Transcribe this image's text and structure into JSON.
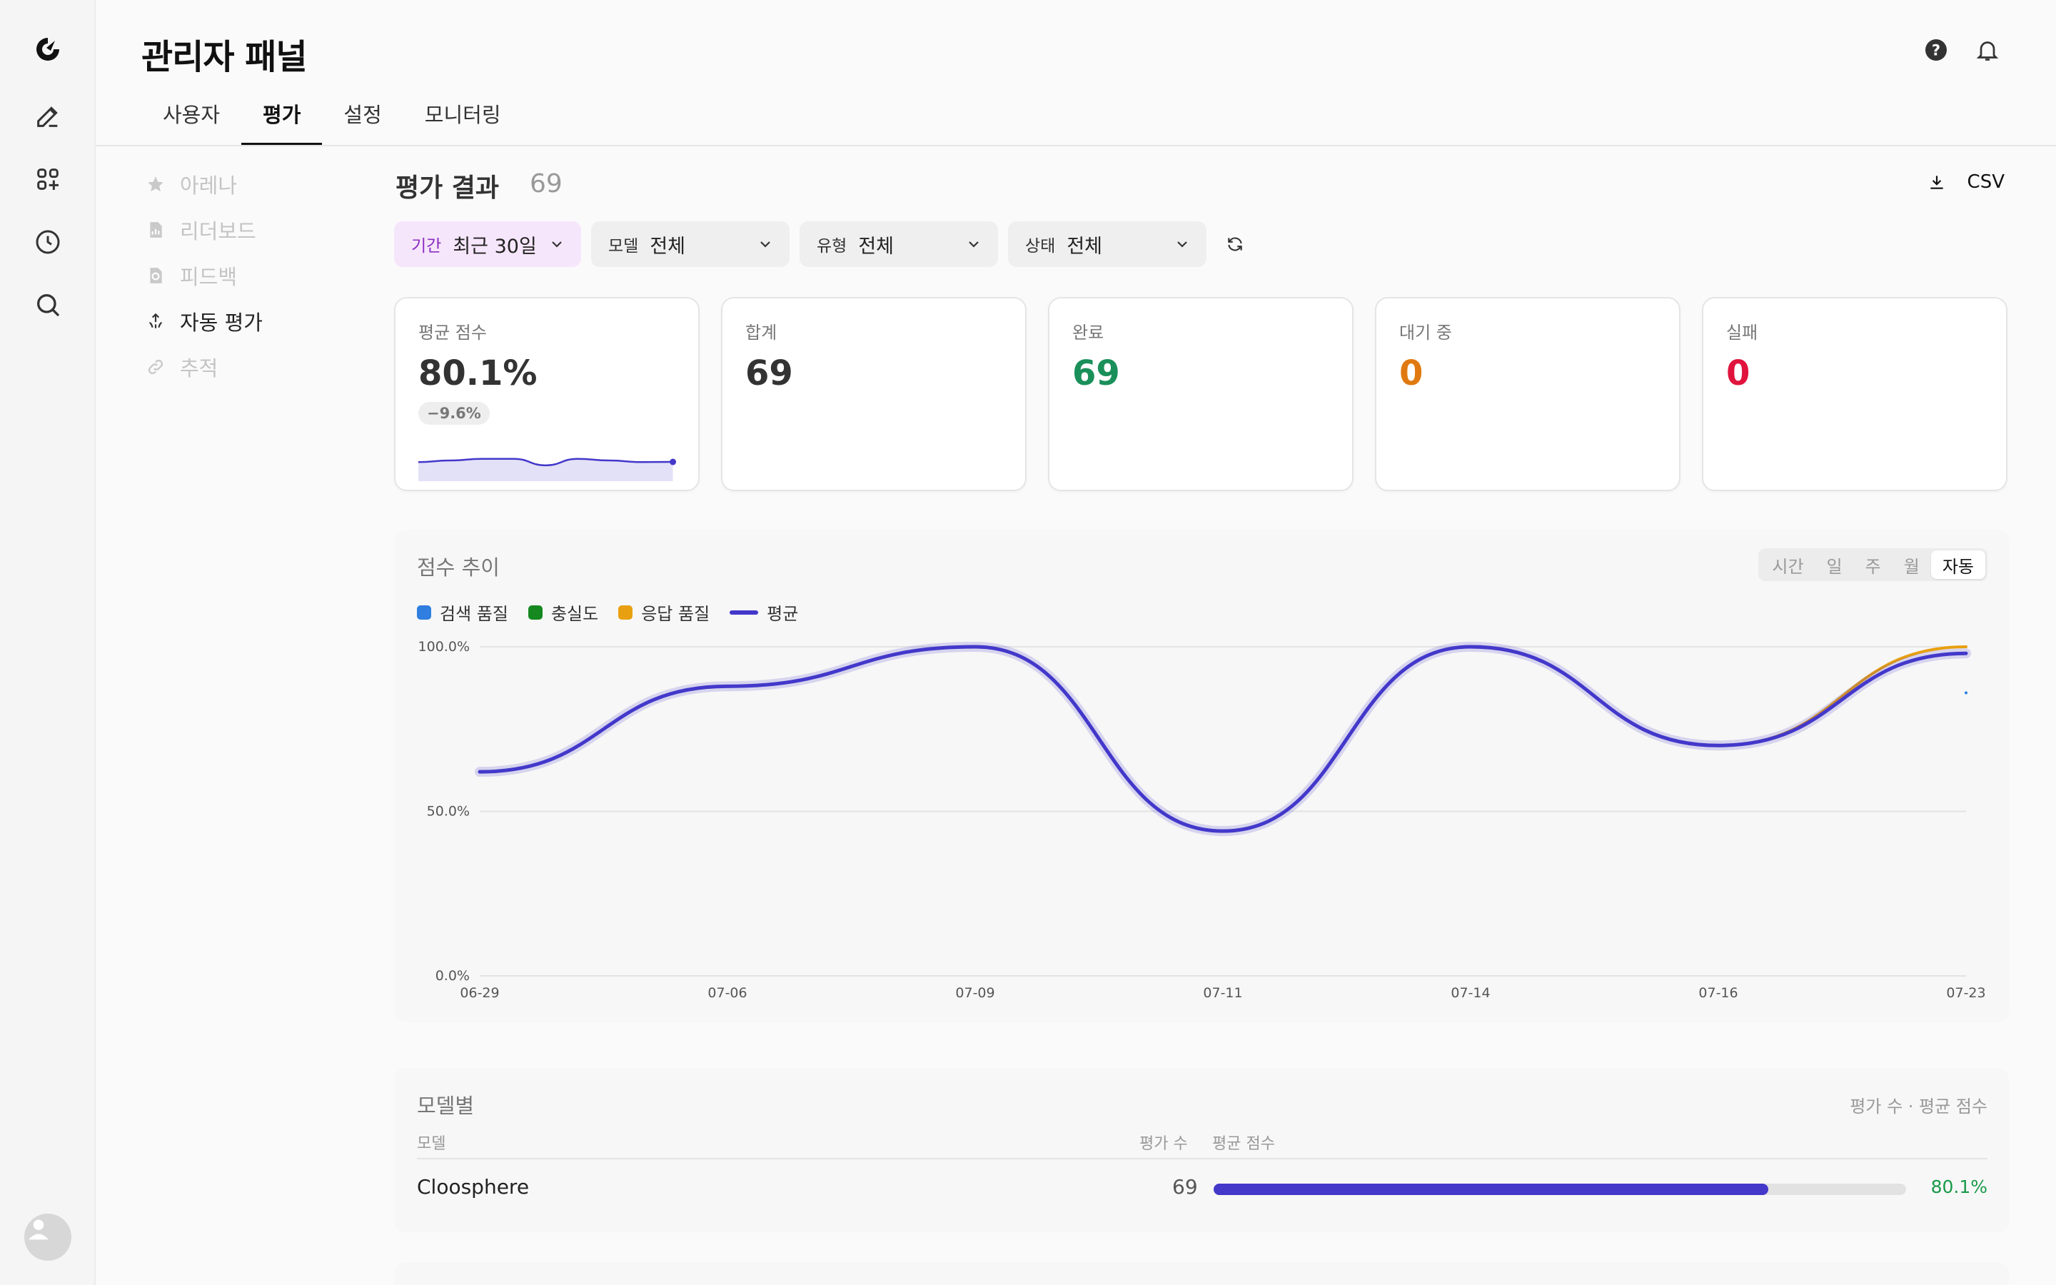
{
  "app": {
    "title": "관리자 패널"
  },
  "tabs": [
    {
      "label": "사용자",
      "active": false
    },
    {
      "label": "평가",
      "active": true
    },
    {
      "label": "설정",
      "active": false
    },
    {
      "label": "모니터링",
      "active": false
    }
  ],
  "subnav": [
    {
      "label": "아레나",
      "icon": "star-icon",
      "active": false
    },
    {
      "label": "리더보드",
      "icon": "chart-doc-icon",
      "active": false
    },
    {
      "label": "피드백",
      "icon": "feedback-doc-icon",
      "active": false
    },
    {
      "label": "자동 평가",
      "icon": "auto-eval-icon",
      "active": true
    },
    {
      "label": "추적",
      "icon": "link-icon",
      "active": false
    }
  ],
  "results": {
    "title": "평가 결과",
    "count": "69",
    "export_label": "CSV"
  },
  "filters": {
    "period": {
      "label": "기간",
      "value": "최근 30일"
    },
    "model": {
      "label": "모델",
      "value": "전체"
    },
    "type": {
      "label": "유형",
      "value": "전체"
    },
    "status": {
      "label": "상태",
      "value": "전체"
    }
  },
  "stats": [
    {
      "label": "평균 점수",
      "value": "80.1%",
      "delta": "−9.6%",
      "color": "#333333"
    },
    {
      "label": "합계",
      "value": "69",
      "color": "#333333"
    },
    {
      "label": "완료",
      "value": "69",
      "color": "#1a8f5a"
    },
    {
      "label": "대기 중",
      "value": "0",
      "color": "#e07a10"
    },
    {
      "label": "실패",
      "value": "0",
      "color": "#e0143c"
    }
  ],
  "trend": {
    "title": "점수 추이",
    "granularity": [
      "시간",
      "일",
      "주",
      "월",
      "자동"
    ],
    "granularity_selected": "자동"
  },
  "chart_data": {
    "type": "line",
    "title": "점수 추이",
    "x": [
      "06-29",
      "07-06",
      "07-09",
      "07-11",
      "07-14",
      "07-16",
      "07-23"
    ],
    "ylim": [
      0,
      100
    ],
    "yticks": [
      "0.0%",
      "50.0%",
      "100.0%"
    ],
    "legend": "top-left",
    "grid": true,
    "series": [
      {
        "name": "검색 품질",
        "color": "#2f7ee0",
        "values": [
          62,
          88,
          100,
          44,
          100,
          70,
          98
        ]
      },
      {
        "name": "충실도",
        "color": "#15891f",
        "values": [
          62,
          88,
          100,
          44,
          100,
          70,
          98
        ]
      },
      {
        "name": "응답 품질",
        "color": "#e8a010",
        "values": [
          62,
          88,
          100,
          44,
          100,
          70,
          100
        ]
      },
      {
        "name": "평균",
        "color": "#4338ca",
        "values": [
          62,
          88,
          100,
          44,
          100,
          70,
          98
        ]
      }
    ]
  },
  "spark": {
    "values": [
      80,
      81,
      82,
      82,
      78,
      82,
      81,
      80,
      80.1
    ],
    "color": "#4338ca"
  },
  "models": {
    "title": "모델별",
    "subtitle": "평가 수 · 평균 점수",
    "headers": {
      "model": "모델",
      "count": "평가 수",
      "score": "평균 점수"
    },
    "rows": [
      {
        "name": "Cloosphere",
        "count": "69",
        "score": "80.1%",
        "score_fraction": 0.801
      }
    ]
  }
}
